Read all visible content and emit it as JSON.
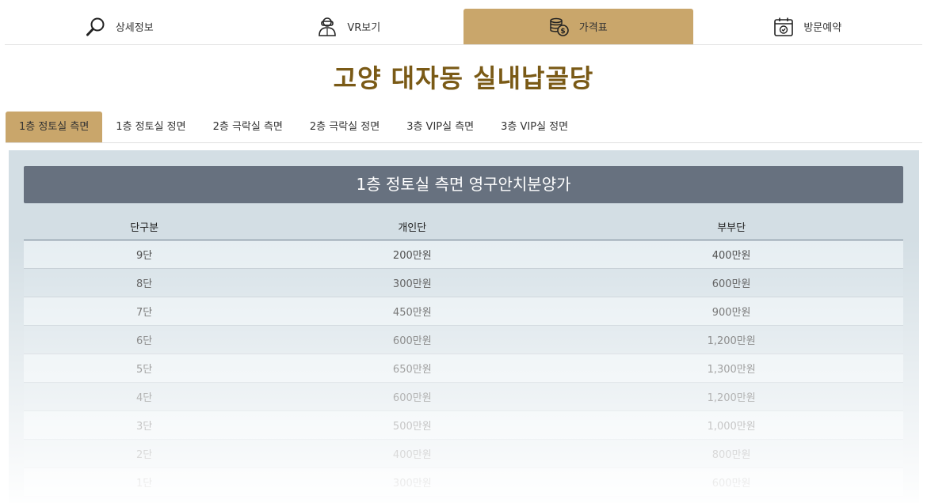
{
  "nav": {
    "items": [
      {
        "label": "상세정보",
        "icon": "magnifier-icon"
      },
      {
        "label": "VR보기",
        "icon": "vr-person-icon"
      },
      {
        "label": "가격표",
        "icon": "coins-icon"
      },
      {
        "label": "방문예약",
        "icon": "calendar-icon"
      }
    ],
    "active": "가격표"
  },
  "title": "고양 대자동 실내납골당",
  "subtabs": [
    "1층 정토실 측면",
    "1층 정토실 정면",
    "2층 극락실 측면",
    "2층 극락실 정면",
    "3층 VIP실 측면",
    "3층 VIP실 정면"
  ],
  "active_subtab": "1층 정토실 측면",
  "price_table": {
    "heading": "1층 정토실 측면 영구안치분양가",
    "columns": [
      "단구분",
      "개인단",
      "부부단"
    ],
    "rows": [
      [
        "9단",
        "200만원",
        "400만원"
      ],
      [
        "8단",
        "300만원",
        "600만원"
      ],
      [
        "7단",
        "450만원",
        "900만원"
      ],
      [
        "6단",
        "600만원",
        "1,200만원"
      ],
      [
        "5단",
        "650만원",
        "1,300만원"
      ],
      [
        "4단",
        "600만원",
        "1,200만원"
      ],
      [
        "3단",
        "500만원",
        "1,000만원"
      ],
      [
        "2단",
        "400만원",
        "800만원"
      ],
      [
        "1단",
        "300만원",
        "600만원"
      ]
    ]
  },
  "colors": {
    "accent": "#c9a66b",
    "title": "#7a5a16",
    "table_head": "#67717f",
    "panel_bg": "#d3dee4"
  }
}
